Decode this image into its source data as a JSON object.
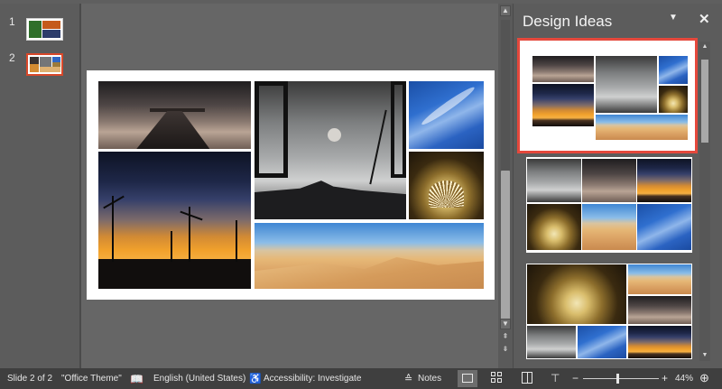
{
  "thumbnails": [
    {
      "number": "1",
      "selected": false
    },
    {
      "number": "2",
      "selected": true
    }
  ],
  "design_pane": {
    "title": "Design Ideas",
    "menu_icon": "dropdown-triangle-icon",
    "close_icon": "close-icon"
  },
  "status_bar": {
    "slide_info": "Slide 2 of 2",
    "theme": "\"Office Theme\"",
    "language": "English (United States)",
    "accessibility": "Accessibility: Investigate",
    "notes": "Notes",
    "zoom_minus": "−",
    "zoom_plus": "+",
    "zoom_level": "44%"
  },
  "colors": {
    "selection_accent": "#e5483c",
    "thumbnail_selected": "#d9482a"
  }
}
